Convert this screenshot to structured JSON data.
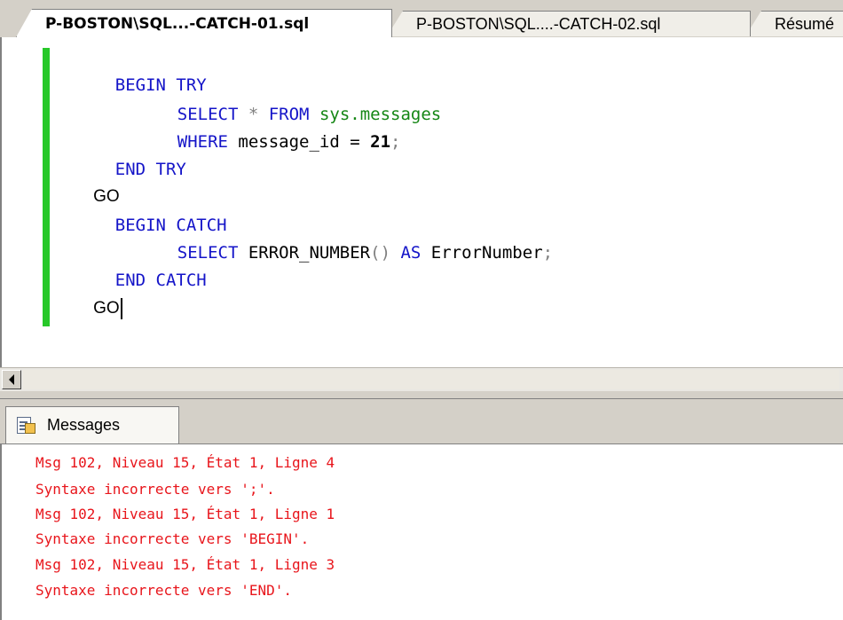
{
  "doc_tabs": [
    {
      "label": "P-BOSTON\\SQL...-CATCH-01.sql",
      "active": true
    },
    {
      "label": "P-BOSTON\\SQL....-CATCH-02.sql",
      "active": false
    },
    {
      "label": "Résumé",
      "active": false
    }
  ],
  "editor": {
    "lines": [
      {
        "text": "BEGIN TRY"
      },
      {
        "kw1": "SELECT",
        "op": " * ",
        "kw2": "FROM",
        "obj": "sys.messages"
      },
      {
        "kw": "WHERE",
        "text": " message_id = ",
        "num": "21",
        "op": ";"
      },
      {
        "text": "END TRY"
      },
      {
        "text": "GO"
      },
      {
        "text": "BEGIN CATCH"
      },
      {
        "kw1": "SELECT",
        "text": " ERROR_NUMBER",
        "op": "()",
        "kw2": "AS",
        "text2": " ErrorNumber",
        "op2": ";"
      },
      {
        "text": "END CATCH"
      },
      {
        "text": "GO"
      }
    ]
  },
  "results": {
    "tab_label": "Messages",
    "tab_icon": "messages-icon",
    "messages": [
      "Msg 102, Niveau 15, État 1, Ligne 4",
      "Syntaxe incorrecte vers ';'.",
      "Msg 102, Niveau 15, État 1, Ligne 1",
      "Syntaxe incorrecte vers 'BEGIN'.",
      "Msg 102, Niveau 15, État 1, Ligne 3",
      "Syntaxe incorrecte vers 'END'."
    ]
  },
  "colors": {
    "keyword": "#1414c8",
    "system_object": "#148614",
    "operator": "#808080",
    "error_text": "#e8151b",
    "change_bar": "#27c829"
  }
}
